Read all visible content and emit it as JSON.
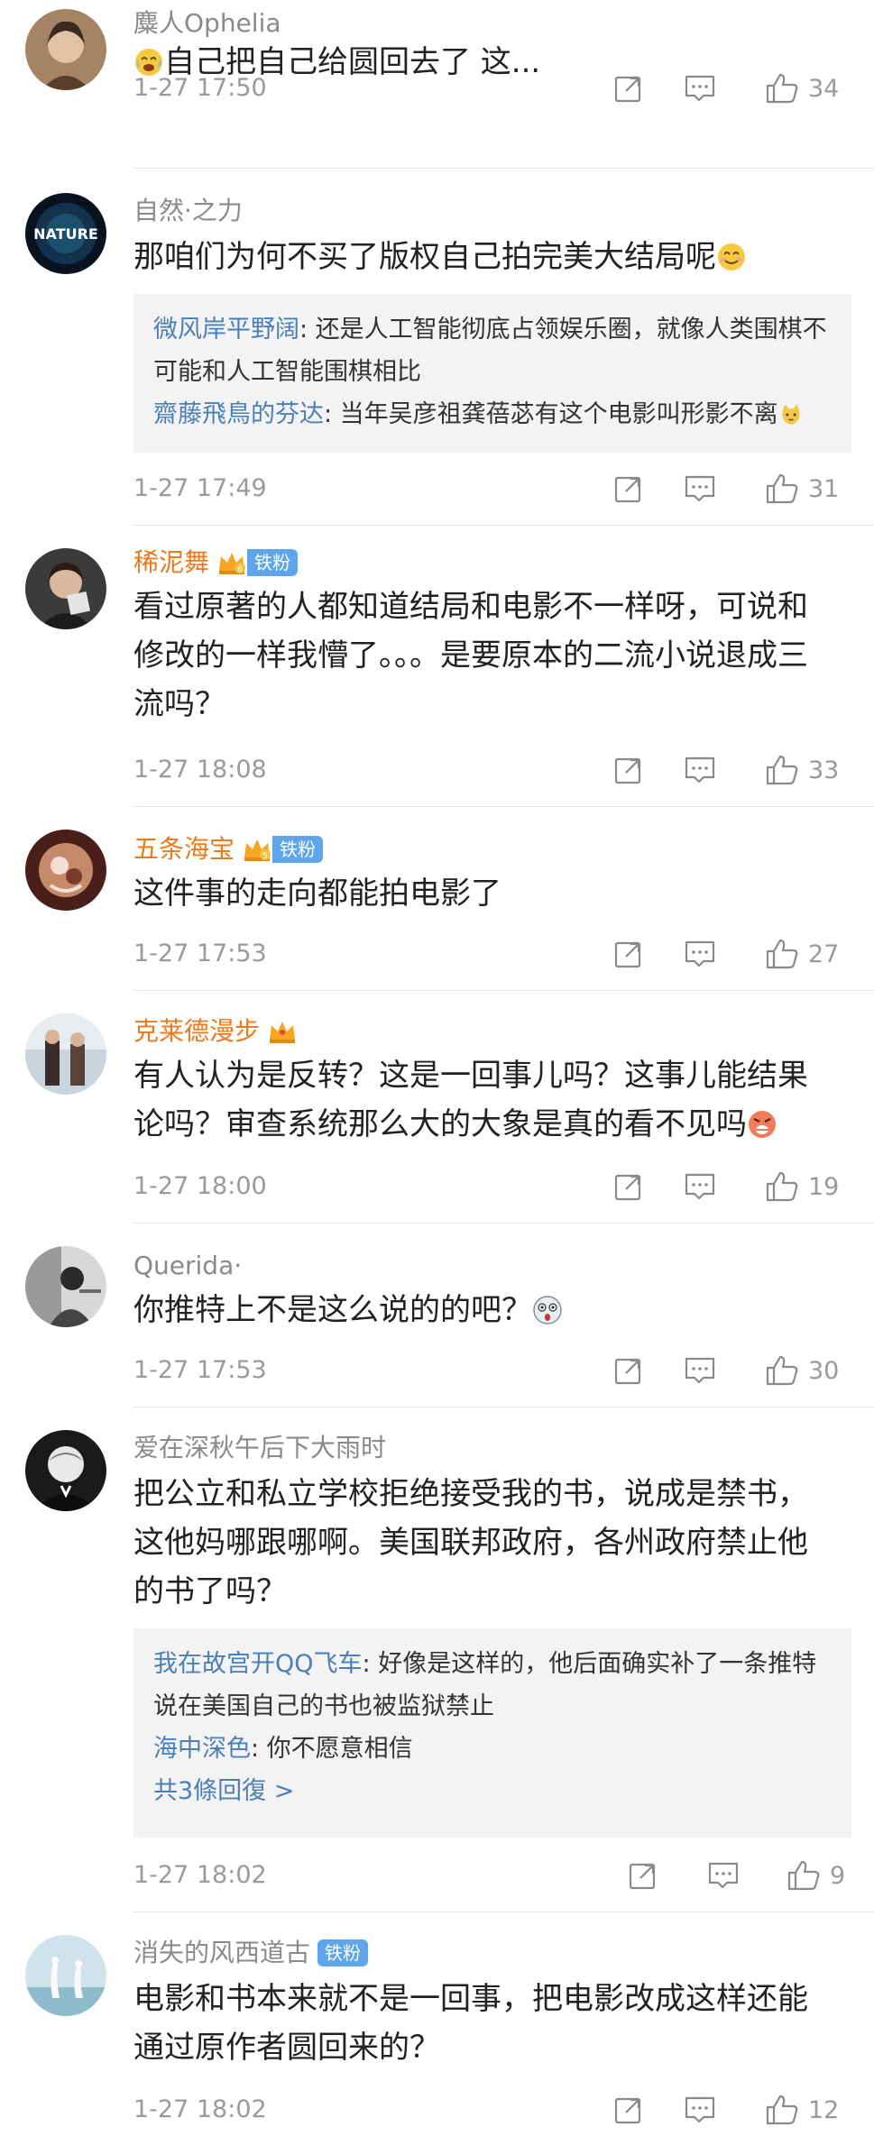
{
  "comments": [
    {
      "user": "麋人Ophelia",
      "name_style": "gray",
      "badge": null,
      "text": "自己把自己给圆回去了 这...",
      "lead_emoji": "crying-laugh-emoji",
      "trail_emoji": null,
      "time": "1-27 17:50",
      "likes": "34",
      "replies": []
    },
    {
      "user": "自然·之力",
      "name_style": "gray",
      "badge": null,
      "text": "那咱们为何不买了版权自己拍完美大结局呢",
      "lead_emoji": null,
      "trail_emoji": "smile-emoji",
      "time": "1-27 17:49",
      "likes": "31",
      "replies": [
        {
          "name": "微风岸平野阔",
          "text": ": 还是人工智能彻底占领娱乐圈，就像人类围棋不可能和人工智能围棋相比"
        },
        {
          "name": "齋藤飛鳥的芬达",
          "text": ": 当年吴彦祖龚蓓苾有这个电影叫形影不离"
        }
      ],
      "more": null
    },
    {
      "user": "稀泥舞",
      "name_style": "orange",
      "badge": {
        "crown": true,
        "tag": "铁粉"
      },
      "text": "看过原著的人都知道结局和电影不一样呀，可说和修改的一样我懵了。。。是要原本的二流小说退成三流吗？",
      "lead_emoji": null,
      "trail_emoji": null,
      "time": "1-27 18:08",
      "likes": "33",
      "replies": []
    },
    {
      "user": "五条海宝",
      "name_style": "orange",
      "badge": {
        "crown": true,
        "tag": "铁粉"
      },
      "text": "这件事的走向都能拍电影了",
      "lead_emoji": null,
      "trail_emoji": null,
      "time": "1-27 17:53",
      "likes": "27",
      "replies": []
    },
    {
      "user": "克莱德漫步",
      "name_style": "orange",
      "badge": {
        "crown": true,
        "tag": null
      },
      "text": "有人认为是反转？这是一回事儿吗？这事儿能结果论吗？审查系统那么大的大象是真的看不见吗",
      "lead_emoji": null,
      "trail_emoji": "angry-emoji",
      "time": "1-27 18:00",
      "likes": "19",
      "replies": []
    },
    {
      "user": "Querida·",
      "name_style": "gray",
      "badge": null,
      "text": "你推特上不是这么说的的吧？",
      "lead_emoji": null,
      "trail_emoji": "shocked-emoji",
      "time": "1-27 17:53",
      "likes": "30",
      "replies": []
    },
    {
      "user": "爱在深秋午后下大雨时",
      "name_style": "gray",
      "badge": null,
      "text": "把公立和私立学校拒绝接受我的书，说成是禁书，这他妈哪跟哪啊。美国联邦政府，各州政府禁止他的书了吗？",
      "lead_emoji": null,
      "trail_emoji": null,
      "time": "1-27 18:02",
      "likes": "9",
      "replies": [
        {
          "name": "我在故宫开QQ飞车",
          "text": ": 好像是这样的，他后面确实补了一条推特说在美国自己的书也被监狱禁止"
        },
        {
          "name": "海中深色",
          "text": ": 你不愿意相信"
        }
      ],
      "more": "共3條回復 >"
    },
    {
      "user": "消失的风西道古",
      "name_style": "gray",
      "badge": {
        "crown": false,
        "tag": "铁粉"
      },
      "text": "电影和书本来就不是一回事，把电影改成这样还能通过原作者圆回来的？",
      "lead_emoji": null,
      "trail_emoji": null,
      "time": "1-27 18:02",
      "likes": "12",
      "replies": []
    }
  ]
}
